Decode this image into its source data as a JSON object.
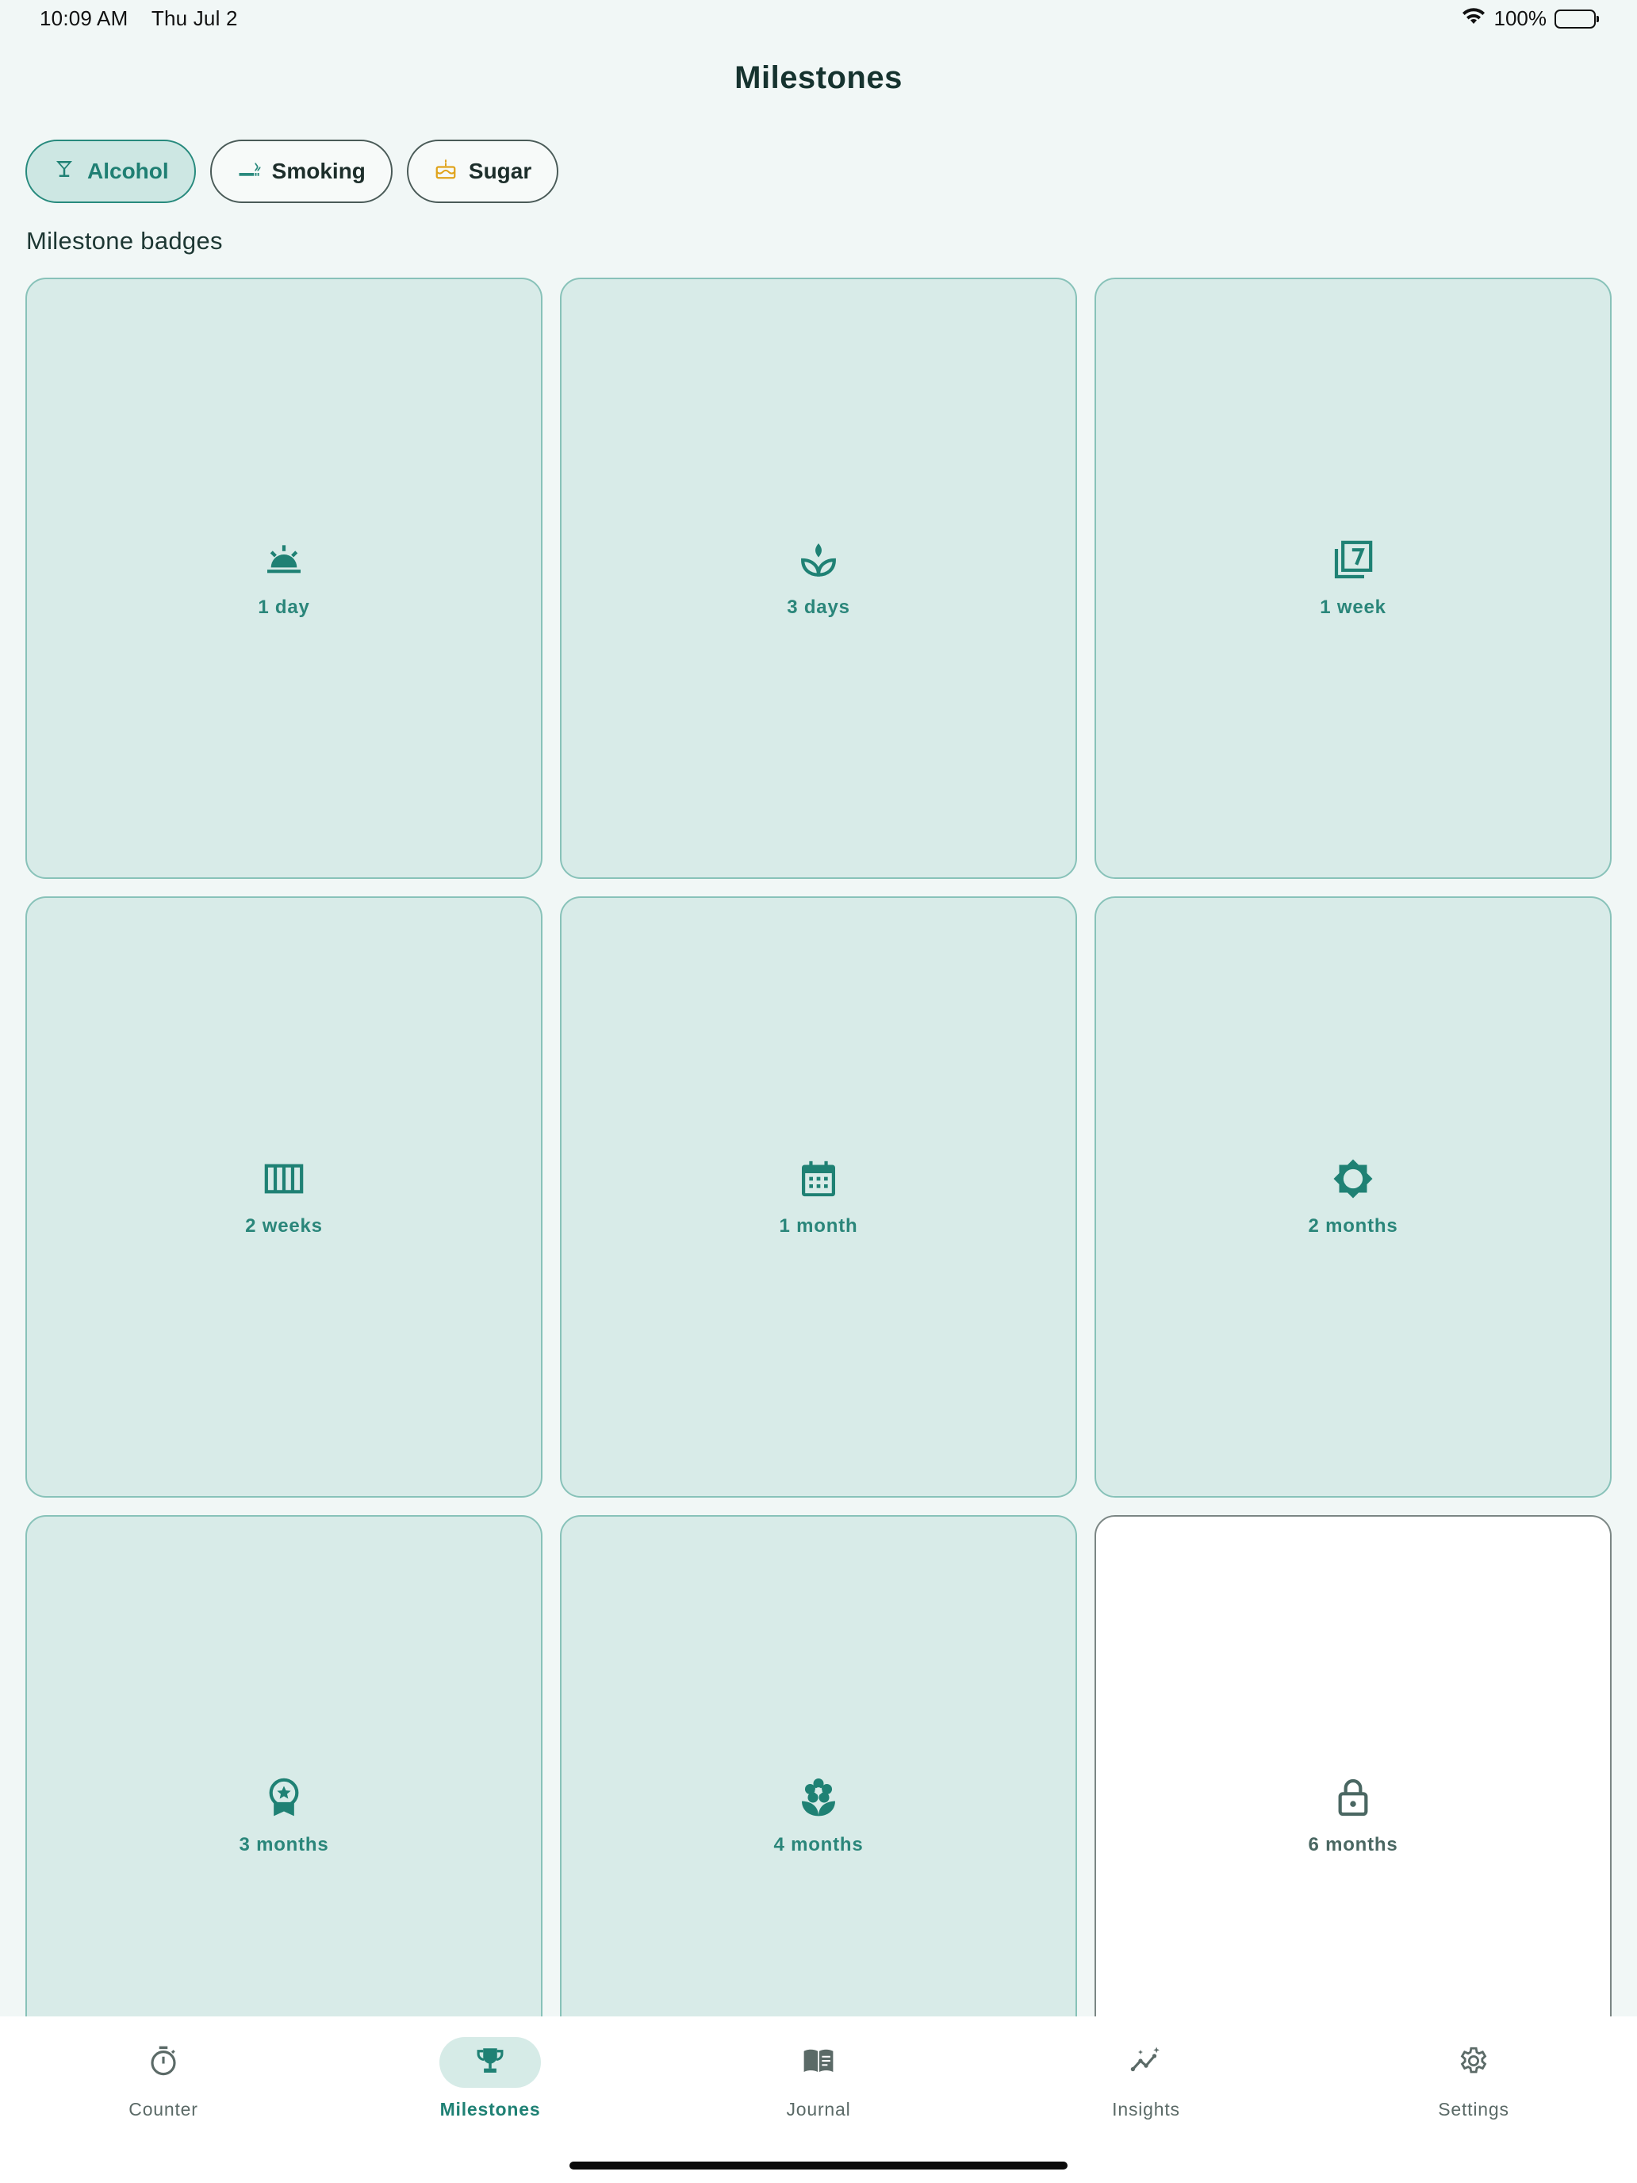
{
  "status_bar": {
    "time": "10:09 AM",
    "date": "Thu Jul 2",
    "battery": "100%"
  },
  "header": {
    "title": "Milestones"
  },
  "filters": [
    {
      "label": "Alcohol",
      "icon": "cocktail-glass-icon",
      "active": true
    },
    {
      "label": "Smoking",
      "icon": "cigarette-icon",
      "active": false
    },
    {
      "label": "Sugar",
      "icon": "cake-icon",
      "active": false
    }
  ],
  "section": {
    "label": "Milestone badges"
  },
  "badges": [
    {
      "label": "1 day",
      "icon": "sunrise-icon",
      "unlocked": true
    },
    {
      "label": "3 days",
      "icon": "sprout-icon",
      "unlocked": true
    },
    {
      "label": "1 week",
      "icon": "filter-7-icon",
      "unlocked": true
    },
    {
      "label": "2 weeks",
      "icon": "calendar-view-week-icon",
      "unlocked": true
    },
    {
      "label": "1 month",
      "icon": "calendar-month-icon",
      "unlocked": true
    },
    {
      "label": "2 months",
      "icon": "brightness-icon",
      "unlocked": true
    },
    {
      "label": "3 months",
      "icon": "award-ribbon-icon",
      "unlocked": true
    },
    {
      "label": "4 months",
      "icon": "flower-icon",
      "unlocked": true
    },
    {
      "label": "6 months",
      "icon": "lock-icon",
      "unlocked": false
    }
  ],
  "tabs": [
    {
      "label": "Counter",
      "icon": "timer-icon",
      "active": false
    },
    {
      "label": "Milestones",
      "icon": "trophy-icon",
      "active": true
    },
    {
      "label": "Journal",
      "icon": "book-icon",
      "active": false
    },
    {
      "label": "Insights",
      "icon": "insights-icon",
      "active": false
    },
    {
      "label": "Settings",
      "icon": "gear-icon",
      "active": false
    }
  ],
  "colors": {
    "accent": "#1f8174",
    "badge_fill": "#d8ebe8",
    "badge_border": "#88c2b9",
    "sugar_icon": "#e0a31c"
  }
}
